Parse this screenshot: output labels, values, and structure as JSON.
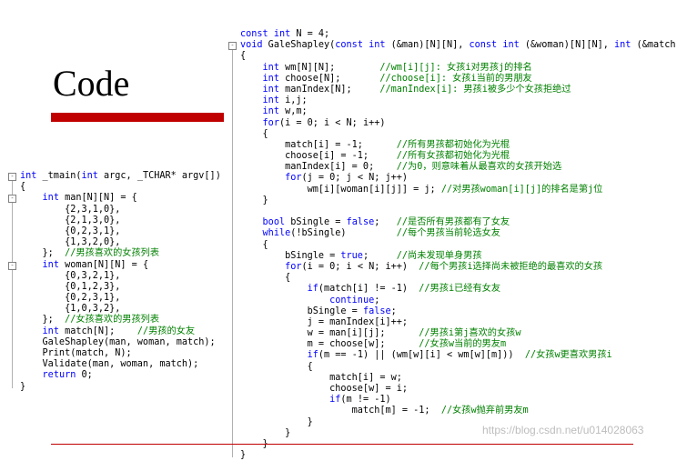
{
  "slide": {
    "title": "Code",
    "watermark": "https://blog.csdn.net/u014028063"
  },
  "left_code": [
    "int _tmain(int argc, _TCHAR* argv[])",
    "{",
    "    int man[N][N] = {",
    "        {2,3,1,0},",
    "        {2,1,3,0},",
    "        {0,2,3,1},",
    "        {1,3,2,0},",
    "    };  //男孩喜欢的女孩列表",
    "    int woman[N][N] = {",
    "        {0,3,2,1},",
    "        {0,1,2,3},",
    "        {0,2,3,1},",
    "        {1,0,3,2},",
    "    };  //女孩喜欢的男孩列表",
    "    int match[N];    //男孩的女友",
    "    GaleShapley(man, woman, match);",
    "    Print(match, N);",
    "    Validate(man, woman, match);",
    "    return 0;",
    "}"
  ],
  "right_code": [
    "const int N = 4;",
    "void GaleShapley(const int (&man)[N][N], const int (&woman)[N][N], int (&match)[N])",
    "{",
    "    int wm[N][N];        //wm[i][j]: 女孩i对男孩j的排名",
    "    int choose[N];       //choose[i]: 女孩i当前的男朋友",
    "    int manIndex[N];     //manIndex[i]: 男孩i被多少个女孩拒绝过",
    "    int i,j;",
    "    int w,m;",
    "    for(i = 0; i < N; i++)",
    "    {",
    "        match[i] = -1;      //所有男孩都初始化为光棍",
    "        choose[i] = -1;     //所有女孩都初始化为光棍",
    "        manIndex[i] = 0;    //为0，则意味着从最喜欢的女孩开始选",
    "        for(j = 0; j < N; j++)",
    "            wm[i][woman[i][j]] = j; //对男孩woman[i][j]的排名是第j位",
    "    }",
    "",
    "    bool bSingle = false;   //是否所有男孩都有了女友",
    "    while(!bSingle)         //每个男孩当前轮选女友",
    "    {",
    "        bSingle = true;     //尚未发现单身男孩",
    "        for(i = 0; i < N; i++)  //每个男孩i选择尚未被拒绝的最喜欢的女孩",
    "        {",
    "            if(match[i] != -1)  //男孩i已经有女友",
    "                continue;",
    "            bSingle = false;",
    "            j = manIndex[i]++;",
    "            w = man[i][j];      //男孩i第j喜欢的女孩w",
    "            m = choose[w];      //女孩w当前的男友m",
    "            if(m == -1) || (wm[w][i] < wm[w][m]))  //女孩w更喜欢男孩i",
    "            {",
    "                match[i] = w;",
    "                choose[w] = i;",
    "                if(m != -1)",
    "                    match[m] = -1;  //女孩w抛弃前男友m",
    "            }",
    "        }",
    "    }",
    "}"
  ]
}
